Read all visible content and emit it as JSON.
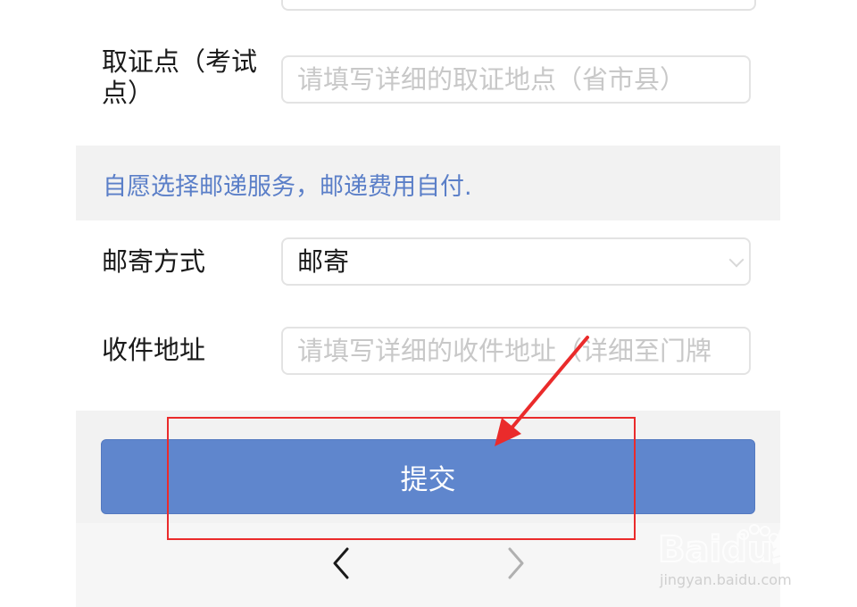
{
  "form": {
    "pickup_point": {
      "label": "取证点（考试点）",
      "label_line1": "取证点（考试",
      "label_line2": "点）",
      "placeholder": "请填写详细的取证地点（省市县）"
    },
    "notice": "自愿选择邮递服务，邮递费用自付.",
    "delivery_method": {
      "label": "邮寄方式",
      "selected": "邮寄"
    },
    "address": {
      "label": "收件地址",
      "placeholder": "请填写详细的收件地址（详细至门牌"
    },
    "submit_label": "提交"
  },
  "navigation": {
    "back_icon": "chevron-left-icon",
    "forward_icon": "chevron-right-icon"
  },
  "watermark": {
    "brand": "Baidu经验",
    "url": "jingyan.baidu.com"
  },
  "colors": {
    "accent": "#5f86cd",
    "notice_text": "#5b7fc8",
    "annotation": "#ea2b2b"
  }
}
